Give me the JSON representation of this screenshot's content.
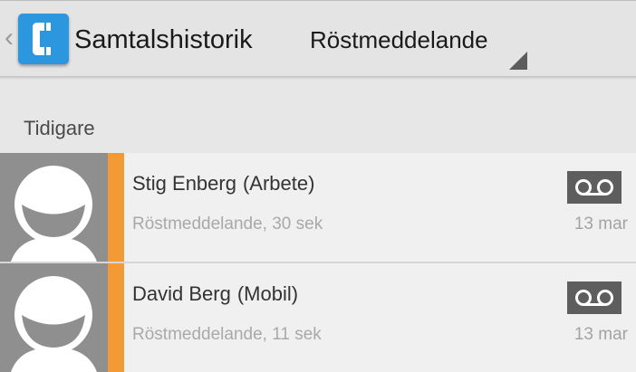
{
  "actionbar": {
    "title": "Samtalshistorik",
    "filter": {
      "selected": "Röstmeddelande"
    }
  },
  "section": {
    "header": "Tidigare"
  },
  "calls": [
    {
      "name": "Stig Enberg",
      "label": "(Arbete)",
      "detail": "Röstmeddelande, 30 sek",
      "date": "13 mar",
      "icon": "voicemail-icon"
    },
    {
      "name": "David Berg",
      "label": "(Mobil)",
      "detail": "Röstmeddelande, 11 sek",
      "date": "13 mar",
      "icon": "voicemail-icon"
    }
  ],
  "colors": {
    "accent": "#f39a36",
    "app_icon": "#2c97de",
    "avatar_bg": "#8f8f8f"
  }
}
